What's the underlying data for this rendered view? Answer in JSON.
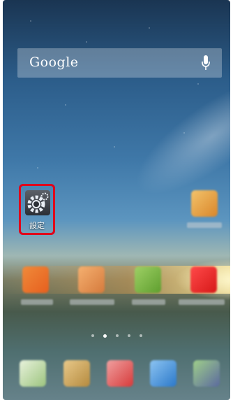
{
  "search": {
    "logo_text": "Google"
  },
  "home_apps": [
    {
      "label": "設定",
      "icon": "gear-icon",
      "highlighted": true,
      "highlight_color": "#e0001b"
    }
  ],
  "page_indicator": {
    "count": 5,
    "active_index": 1
  }
}
